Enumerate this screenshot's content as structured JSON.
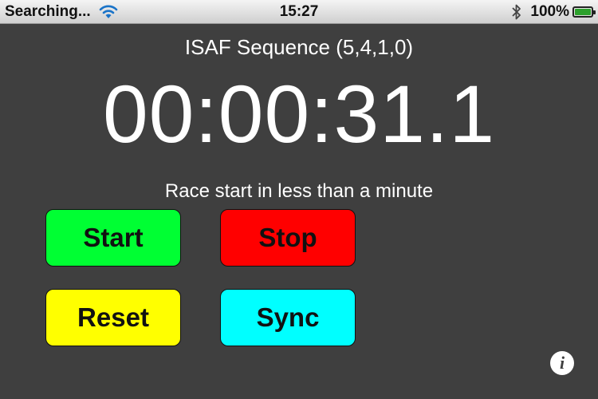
{
  "status_bar": {
    "carrier": "Searching...",
    "time": "15:27",
    "battery_percent": "100%",
    "battery_level": 1.0,
    "icons": [
      "wifi-icon",
      "bluetooth-icon",
      "battery-icon"
    ]
  },
  "main": {
    "sequence_title": "ISAF Sequence (5,4,1,0)",
    "timer": "00:00:31.1",
    "status_message": "Race start in less than a minute"
  },
  "buttons": {
    "start": "Start",
    "stop": "Stop",
    "reset": "Reset",
    "sync": "Sync"
  },
  "info_button": {
    "glyph": "i",
    "icon": "info-icon"
  },
  "colors": {
    "background": "#3f3f3f",
    "start": "#00ff33",
    "stop": "#ff0000",
    "reset": "#ffff00",
    "sync": "#00ffff"
  }
}
